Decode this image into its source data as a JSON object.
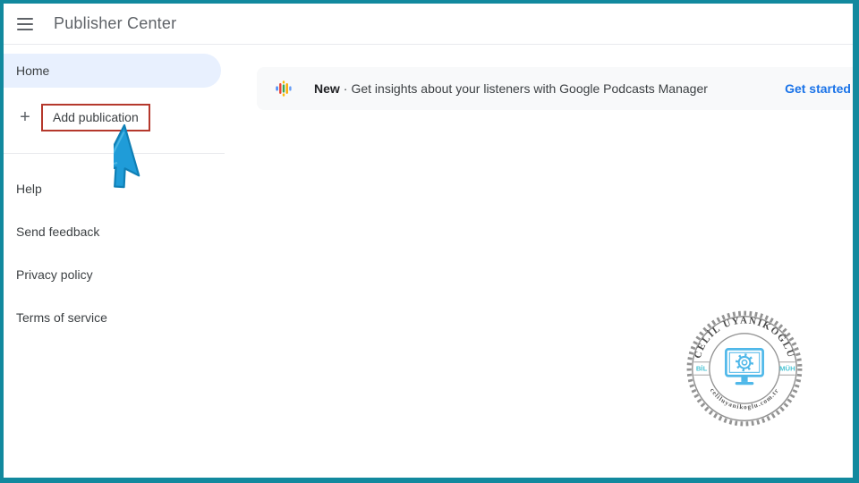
{
  "window": {
    "frame_color": "#12899e"
  },
  "header": {
    "title": "Publisher Center"
  },
  "sidebar": {
    "home": {
      "label": "Home",
      "active_bg": "#e8f0fe"
    },
    "add_publication": {
      "plus_glyph": "+",
      "label": "Add publication",
      "highlight_box_color": "#b5382c"
    },
    "links": [
      {
        "label": "Help"
      },
      {
        "label": "Send feedback"
      },
      {
        "label": "Privacy policy"
      },
      {
        "label": "Terms of service"
      }
    ]
  },
  "banner": {
    "icon": "google-podcasts-icon",
    "badge": "New",
    "separator": "·",
    "message": "Get insights about your listeners with Google Podcasts Manager",
    "action": "Get started",
    "action_color": "#1a73e8"
  },
  "cursor": {
    "color": "#1f9cd8"
  },
  "watermark": {
    "top_text": "CELİL UYANIKOĞLU",
    "bottom_text": "celiluyanikoglu.com.tr",
    "left_text": "BİL",
    "right_text": "MÜH",
    "accent_color": "#3bbfd1",
    "monitor_color": "#41b2e8"
  }
}
